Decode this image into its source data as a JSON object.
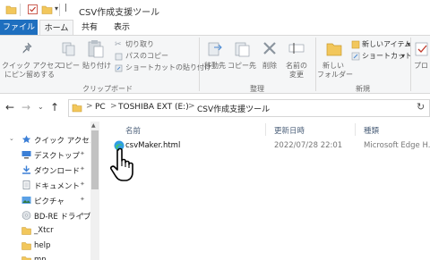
{
  "window": {
    "title": "CSV作成支援ツール"
  },
  "ribbon_tabs": [
    {
      "label": "ファイル"
    },
    {
      "label": "ホーム"
    },
    {
      "label": "共有"
    },
    {
      "label": "表示"
    }
  ],
  "ribbon": {
    "clipboard": {
      "pin_label_1": "クイック アクセス",
      "pin_label_2": "にピン留めする",
      "copy": "コピー",
      "paste": "貼り付け",
      "cut": "切り取り",
      "copy_path": "パスのコピー",
      "paste_shortcut": "ショートカットの貼り付け",
      "group": "クリップボード"
    },
    "organize": {
      "move_to": "移動先",
      "copy_to": "コピー先",
      "delete": "削除",
      "rename_1": "名前の",
      "rename_2": "変更",
      "group": "整理"
    },
    "new": {
      "new_folder_1": "新しい",
      "new_folder_2": "フォルダー",
      "new_item": "新しいアイテム",
      "shortcut": "ショートカット",
      "group": "新規"
    },
    "open": {
      "properties": "プロ"
    }
  },
  "address": {
    "crumbs": [
      "PC",
      "TOSHIBA EXT (E:)",
      "CSV作成支援ツール"
    ],
    "separator": ">"
  },
  "nav": {
    "items": [
      {
        "label": "クイック アクセス",
        "icon": "star-icon"
      },
      {
        "label": "デスクトップ",
        "icon": "desktop-icon"
      },
      {
        "label": "ダウンロード",
        "icon": "download-icon"
      },
      {
        "label": "ドキュメント",
        "icon": "document-icon"
      },
      {
        "label": "ピクチャ",
        "icon": "picture-icon"
      },
      {
        "label": "BD-RE ドライブ",
        "icon": "disc-icon"
      },
      {
        "label": "_Xtcr",
        "icon": "folder-icon"
      },
      {
        "label": "help",
        "icon": "folder-icon"
      },
      {
        "label": "mn",
        "icon": "folder-icon"
      }
    ]
  },
  "list": {
    "columns": [
      "名前",
      "更新日時",
      "種類"
    ],
    "rows": [
      {
        "name": "csvMaker.html",
        "modified": "2022/07/28 22:01",
        "type": "Microsoft Edge H..."
      }
    ]
  },
  "colors": {
    "file_tab": "#1e6fbf",
    "ribbon_bg": "#f5f6f7",
    "folder": "#f2c75c",
    "column_header": "#4c607a"
  }
}
